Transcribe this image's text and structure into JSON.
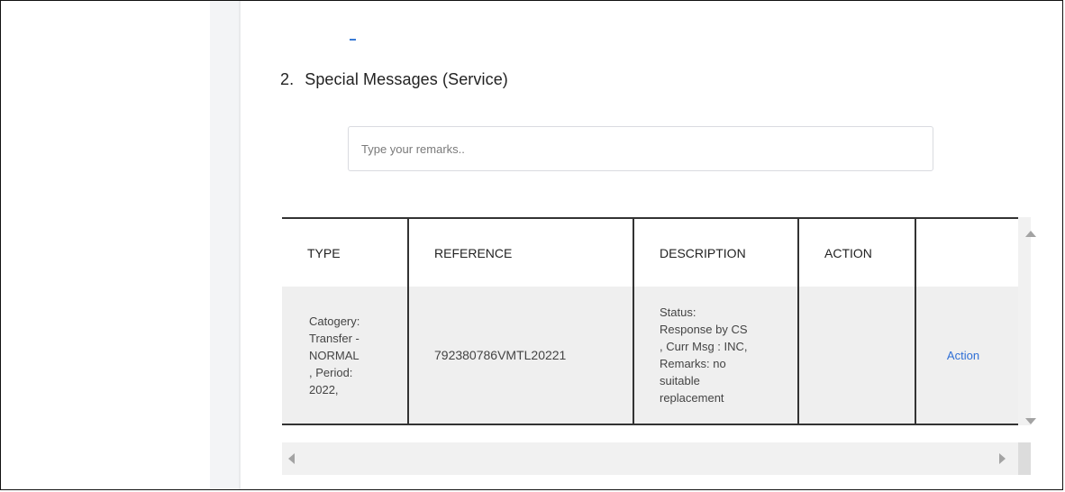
{
  "section": {
    "number": "2.",
    "title": "Special Messages (Service)"
  },
  "remarks": {
    "placeholder": "Type your remarks..",
    "value": ""
  },
  "table": {
    "headers": [
      "TYPE",
      "REFERENCE",
      "DESCRIPTION",
      "ACTION",
      ""
    ],
    "rows": [
      {
        "type_lines": [
          "Catogery:",
          "Transfer -",
          "NORMAL",
          ", Period:",
          "2022,"
        ],
        "reference": "792380786VMTL20221",
        "description_lines": [
          "Status:",
          "Response by CS",
          ", Curr Msg : INC,",
          "Remarks: no",
          "suitable",
          "replacement"
        ],
        "action": "",
        "link": "Action"
      }
    ]
  },
  "colors": {
    "accent": "#2f6fd6",
    "row_bg": "#efefef",
    "rail_bg": "#f3f4f6"
  },
  "icons": {
    "scroll_up": "triangle-up",
    "scroll_down": "triangle-down",
    "scroll_left": "triangle-left",
    "scroll_right": "triangle-right"
  }
}
